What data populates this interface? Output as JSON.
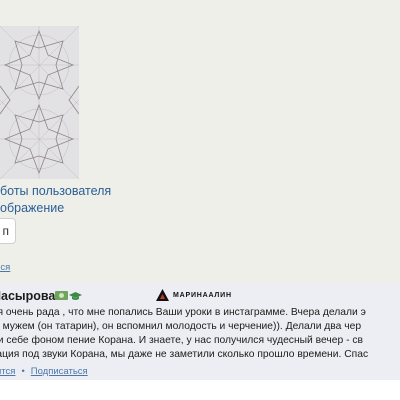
{
  "gallery": {
    "caption_line1": "боты пользователя",
    "caption_line2": "ображение",
    "button_label": "п",
    "subscribe_link": "аться"
  },
  "comment": {
    "author": "Насырова",
    "badges": [
      "money-badge-icon",
      "graduation-cap-icon"
    ],
    "logo_text": "МАРИНААЛИН",
    "lines": [
      "а, я очень рада , что мне попались Ваши уроки в инстаграмме. Вчера делали э",
      "е с мужем (он татарин), он вспомнил молодость и черчение)). Делали два чер",
      "или себе фоном пение Корана. И знаете, у нас получился чудесный вечер - св",
      "итация под звуки Корана, мы даже не заметили сколько прошло времени. Спас"
    ],
    "reply_link": "ится",
    "separator": "•",
    "subscribe_link": "Подписаться"
  },
  "colors": {
    "panel_bg": "#efefea",
    "comment_bg": "#edeef3",
    "link": "#2a5e94",
    "pattern_line": "#9a8a8a"
  }
}
